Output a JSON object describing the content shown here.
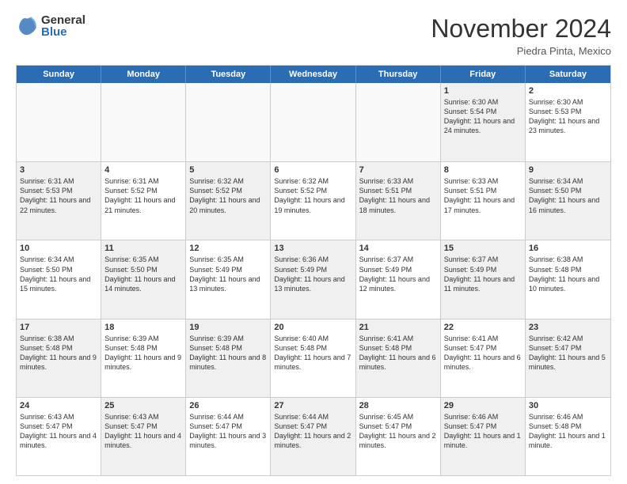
{
  "logo": {
    "general": "General",
    "blue": "Blue"
  },
  "header": {
    "month": "November 2024",
    "location": "Piedra Pinta, Mexico"
  },
  "weekdays": [
    "Sunday",
    "Monday",
    "Tuesday",
    "Wednesday",
    "Thursday",
    "Friday",
    "Saturday"
  ],
  "rows": [
    [
      {
        "day": "",
        "info": "",
        "empty": true
      },
      {
        "day": "",
        "info": "",
        "empty": true
      },
      {
        "day": "",
        "info": "",
        "empty": true
      },
      {
        "day": "",
        "info": "",
        "empty": true
      },
      {
        "day": "",
        "info": "",
        "empty": true
      },
      {
        "day": "1",
        "info": "Sunrise: 6:30 AM\nSunset: 5:54 PM\nDaylight: 11 hours and 24 minutes.",
        "shaded": true
      },
      {
        "day": "2",
        "info": "Sunrise: 6:30 AM\nSunset: 5:53 PM\nDaylight: 11 hours and 23 minutes.",
        "shaded": false
      }
    ],
    [
      {
        "day": "3",
        "info": "Sunrise: 6:31 AM\nSunset: 5:53 PM\nDaylight: 11 hours and 22 minutes.",
        "shaded": true
      },
      {
        "day": "4",
        "info": "Sunrise: 6:31 AM\nSunset: 5:52 PM\nDaylight: 11 hours and 21 minutes.",
        "shaded": false
      },
      {
        "day": "5",
        "info": "Sunrise: 6:32 AM\nSunset: 5:52 PM\nDaylight: 11 hours and 20 minutes.",
        "shaded": true
      },
      {
        "day": "6",
        "info": "Sunrise: 6:32 AM\nSunset: 5:52 PM\nDaylight: 11 hours and 19 minutes.",
        "shaded": false
      },
      {
        "day": "7",
        "info": "Sunrise: 6:33 AM\nSunset: 5:51 PM\nDaylight: 11 hours and 18 minutes.",
        "shaded": true
      },
      {
        "day": "8",
        "info": "Sunrise: 6:33 AM\nSunset: 5:51 PM\nDaylight: 11 hours and 17 minutes.",
        "shaded": false
      },
      {
        "day": "9",
        "info": "Sunrise: 6:34 AM\nSunset: 5:50 PM\nDaylight: 11 hours and 16 minutes.",
        "shaded": true
      }
    ],
    [
      {
        "day": "10",
        "info": "Sunrise: 6:34 AM\nSunset: 5:50 PM\nDaylight: 11 hours and 15 minutes.",
        "shaded": false
      },
      {
        "day": "11",
        "info": "Sunrise: 6:35 AM\nSunset: 5:50 PM\nDaylight: 11 hours and 14 minutes.",
        "shaded": true
      },
      {
        "day": "12",
        "info": "Sunrise: 6:35 AM\nSunset: 5:49 PM\nDaylight: 11 hours and 13 minutes.",
        "shaded": false
      },
      {
        "day": "13",
        "info": "Sunrise: 6:36 AM\nSunset: 5:49 PM\nDaylight: 11 hours and 13 minutes.",
        "shaded": true
      },
      {
        "day": "14",
        "info": "Sunrise: 6:37 AM\nSunset: 5:49 PM\nDaylight: 11 hours and 12 minutes.",
        "shaded": false
      },
      {
        "day": "15",
        "info": "Sunrise: 6:37 AM\nSunset: 5:49 PM\nDaylight: 11 hours and 11 minutes.",
        "shaded": true
      },
      {
        "day": "16",
        "info": "Sunrise: 6:38 AM\nSunset: 5:48 PM\nDaylight: 11 hours and 10 minutes.",
        "shaded": false
      }
    ],
    [
      {
        "day": "17",
        "info": "Sunrise: 6:38 AM\nSunset: 5:48 PM\nDaylight: 11 hours and 9 minutes.",
        "shaded": true
      },
      {
        "day": "18",
        "info": "Sunrise: 6:39 AM\nSunset: 5:48 PM\nDaylight: 11 hours and 9 minutes.",
        "shaded": false
      },
      {
        "day": "19",
        "info": "Sunrise: 6:39 AM\nSunset: 5:48 PM\nDaylight: 11 hours and 8 minutes.",
        "shaded": true
      },
      {
        "day": "20",
        "info": "Sunrise: 6:40 AM\nSunset: 5:48 PM\nDaylight: 11 hours and 7 minutes.",
        "shaded": false
      },
      {
        "day": "21",
        "info": "Sunrise: 6:41 AM\nSunset: 5:48 PM\nDaylight: 11 hours and 6 minutes.",
        "shaded": true
      },
      {
        "day": "22",
        "info": "Sunrise: 6:41 AM\nSunset: 5:47 PM\nDaylight: 11 hours and 6 minutes.",
        "shaded": false
      },
      {
        "day": "23",
        "info": "Sunrise: 6:42 AM\nSunset: 5:47 PM\nDaylight: 11 hours and 5 minutes.",
        "shaded": true
      }
    ],
    [
      {
        "day": "24",
        "info": "Sunrise: 6:43 AM\nSunset: 5:47 PM\nDaylight: 11 hours and 4 minutes.",
        "shaded": false
      },
      {
        "day": "25",
        "info": "Sunrise: 6:43 AM\nSunset: 5:47 PM\nDaylight: 11 hours and 4 minutes.",
        "shaded": true
      },
      {
        "day": "26",
        "info": "Sunrise: 6:44 AM\nSunset: 5:47 PM\nDaylight: 11 hours and 3 minutes.",
        "shaded": false
      },
      {
        "day": "27",
        "info": "Sunrise: 6:44 AM\nSunset: 5:47 PM\nDaylight: 11 hours and 2 minutes.",
        "shaded": true
      },
      {
        "day": "28",
        "info": "Sunrise: 6:45 AM\nSunset: 5:47 PM\nDaylight: 11 hours and 2 minutes.",
        "shaded": false
      },
      {
        "day": "29",
        "info": "Sunrise: 6:46 AM\nSunset: 5:47 PM\nDaylight: 11 hours and 1 minute.",
        "shaded": true
      },
      {
        "day": "30",
        "info": "Sunrise: 6:46 AM\nSunset: 5:48 PM\nDaylight: 11 hours and 1 minute.",
        "shaded": false
      }
    ]
  ]
}
